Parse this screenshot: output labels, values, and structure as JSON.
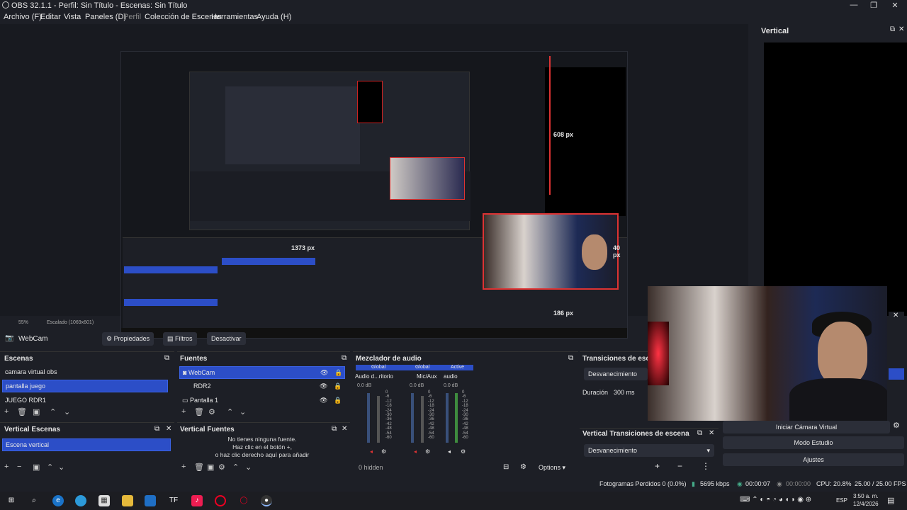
{
  "window": {
    "title": "OBS 32.1.1 - Perfil: Sin Título - Escenas: Sin Título",
    "controls": [
      "—",
      "❐",
      "✕"
    ]
  },
  "menu": [
    "Archivo (F)",
    "Editar",
    "Vista",
    "Paneles (D)",
    "Perfil",
    "Colección de Escenas",
    "Herramientas",
    "Ayuda (H)"
  ],
  "preview": {
    "labels": {
      "px608": "608 px",
      "px1373": "1373 px",
      "px40": "40 px",
      "px186": "186 px"
    },
    "status_left": "55%",
    "status_scale": "Escalado (1069x601)"
  },
  "vertical": {
    "title": "Vertical"
  },
  "source_toolbar": {
    "source": "WebCam",
    "props": "Propiedades",
    "filters": "Filtros",
    "deactivate": "Desactivar"
  },
  "scenes": {
    "title": "Escenas",
    "items": [
      "camara virtual obs",
      "pantalla juego",
      "JUEGO RDR1"
    ],
    "selected": 1
  },
  "sources": {
    "title": "Fuentes",
    "items": [
      "WebCam",
      "RDR2",
      "Pantalla 1"
    ]
  },
  "mixer": {
    "title": "Mezclador de audio",
    "tabs": [
      "Global",
      "Global",
      "Active"
    ],
    "channels": [
      {
        "name": "Audio d...ritorio",
        "db": "0.0 dB"
      },
      {
        "name": "Mic/Aux",
        "db": "0.0 dB"
      },
      {
        "name": "audio",
        "db": "0.0 dB"
      }
    ],
    "scale": [
      "0",
      "-6",
      "-12",
      "-18",
      "-24",
      "-30",
      "-36",
      "-42",
      "-48",
      "-54",
      "-60"
    ],
    "hidden": "0 hidden",
    "options": "Options"
  },
  "transitions": {
    "title": "Transiciones de escena",
    "type": "Desvanecimiento",
    "duration_label": "Duración",
    "duration": "300 ms"
  },
  "vscenes": {
    "title": "Vertical Escenas",
    "items": [
      "Escena vertical"
    ]
  },
  "vsources": {
    "title": "Vertical Fuentes",
    "empty": [
      "No tienes ninguna fuente.",
      "Haz clic en el botón +,",
      "o haz clic derecho aquí para añadir"
    ]
  },
  "vtransitions": {
    "title": "Vertical Transiciones de escena",
    "type": "Desvanecimiento"
  },
  "controls": {
    "vcam": "Iniciar Cámara Virtual",
    "studio": "Modo Estudio",
    "settings": "Ajustes"
  },
  "status": {
    "frames": "Fotogramas Perdidos 0 (0.0%)",
    "kbps": "5695 kbps",
    "rec": "00:00:07",
    "stream": "00:00:00",
    "cpu": "CPU: 20.8%",
    "fps": "25.00 / 25.00 FPS"
  },
  "taskbar": {
    "lang": "ESP",
    "time": "3:50 a. m.",
    "date": "12/4/2026"
  }
}
